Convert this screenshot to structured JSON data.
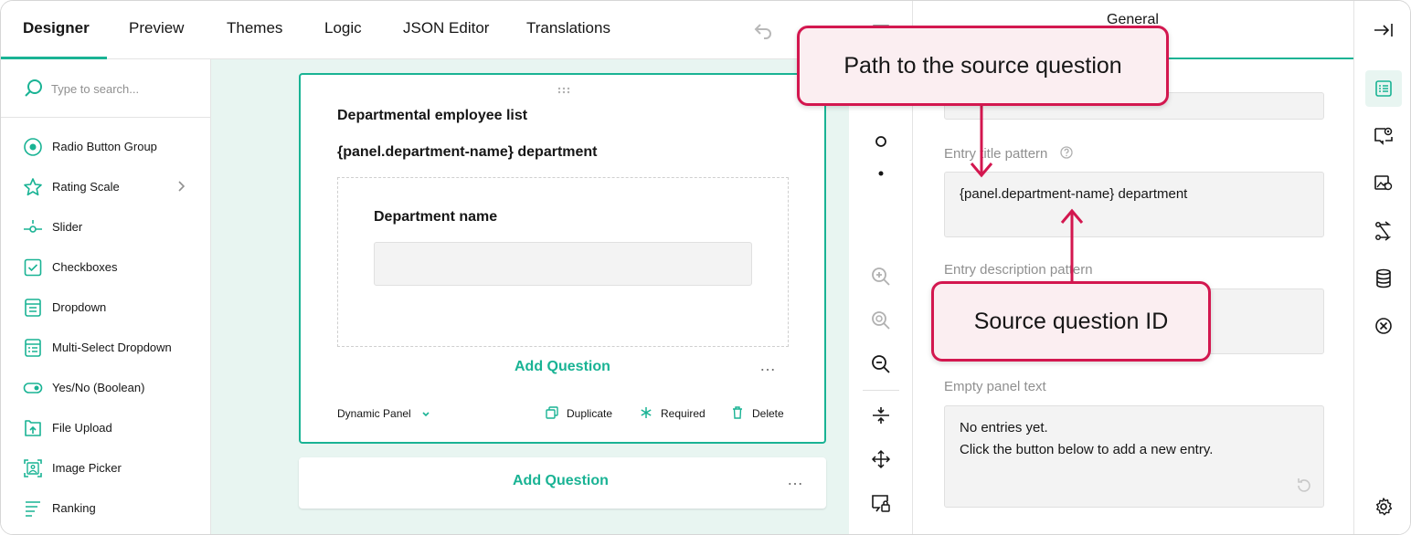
{
  "tabs": [
    "Designer",
    "Preview",
    "Themes",
    "Logic",
    "JSON Editor",
    "Translations"
  ],
  "toolbox": {
    "search_placeholder": "Type to search...",
    "items": [
      {
        "label": "Radio Button Group",
        "icon": "radio-icon"
      },
      {
        "label": "Rating Scale",
        "icon": "star-icon"
      },
      {
        "label": "Slider",
        "icon": "slider-icon"
      },
      {
        "label": "Checkboxes",
        "icon": "checkbox-icon"
      },
      {
        "label": "Dropdown",
        "icon": "dropdown-icon"
      },
      {
        "label": "Multi-Select Dropdown",
        "icon": "multi-select-icon"
      },
      {
        "label": "Yes/No (Boolean)",
        "icon": "toggle-icon"
      },
      {
        "label": "File Upload",
        "icon": "file-upload-icon"
      },
      {
        "label": "Image Picker",
        "icon": "image-picker-icon"
      },
      {
        "label": "Ranking",
        "icon": "ranking-icon"
      }
    ]
  },
  "canvas": {
    "panel_title": "Departmental employee list",
    "panel_description": "{panel.department-name} department",
    "question_title": "Department name",
    "add_question_label": "Add Question",
    "more_label": "…",
    "footer_type": "Dynamic Panel",
    "duplicate_label": "Duplicate",
    "required_label": "Required",
    "delete_label": "Delete"
  },
  "properties": {
    "category": "General",
    "entry_title_label": "Entry title pattern",
    "entry_title_value": "{panel.department-name} department",
    "entry_description_label": "Entry description pattern",
    "empty_panel_label": "Empty panel text",
    "empty_panel_line1": "No entries yet.",
    "empty_panel_line2": "Click the button below to add a new entry."
  },
  "callouts": {
    "path": "Path to the source question",
    "source_id": "Source question ID"
  },
  "colors": {
    "accent": "#19b394",
    "callout_border": "#d3174f",
    "callout_fill": "#fbeef1",
    "canvas_bg": "#e8f5f1"
  }
}
